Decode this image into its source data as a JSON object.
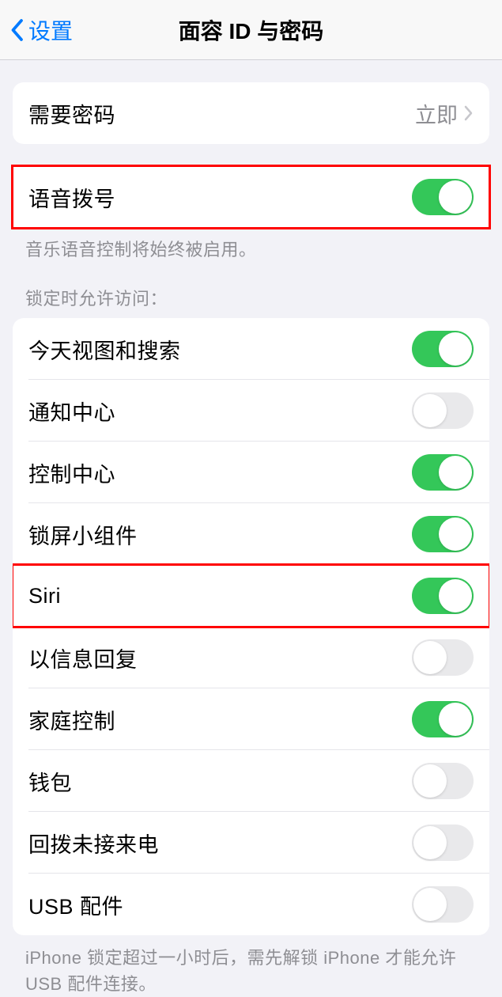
{
  "header": {
    "back_label": "设置",
    "title": "面容 ID 与密码"
  },
  "passcode_group": {
    "require_passcode_label": "需要密码",
    "require_passcode_value": "立即"
  },
  "voice_dial": {
    "label": "语音拨号",
    "on": true,
    "footer": "音乐语音控制将始终被启用。"
  },
  "lock_access": {
    "header": "锁定时允许访问：",
    "items": [
      {
        "label": "今天视图和搜索",
        "on": true,
        "highlighted": false
      },
      {
        "label": "通知中心",
        "on": false,
        "highlighted": false
      },
      {
        "label": "控制中心",
        "on": true,
        "highlighted": false
      },
      {
        "label": "锁屏小组件",
        "on": true,
        "highlighted": false
      },
      {
        "label": "Siri",
        "on": true,
        "highlighted": true
      },
      {
        "label": "以信息回复",
        "on": false,
        "highlighted": false
      },
      {
        "label": "家庭控制",
        "on": true,
        "highlighted": false
      },
      {
        "label": "钱包",
        "on": false,
        "highlighted": false
      },
      {
        "label": "回拨未接来电",
        "on": false,
        "highlighted": false
      },
      {
        "label": "USB 配件",
        "on": false,
        "highlighted": false
      }
    ],
    "footer": "iPhone 锁定超过一小时后，需先解锁 iPhone 才能允许USB 配件连接。"
  }
}
